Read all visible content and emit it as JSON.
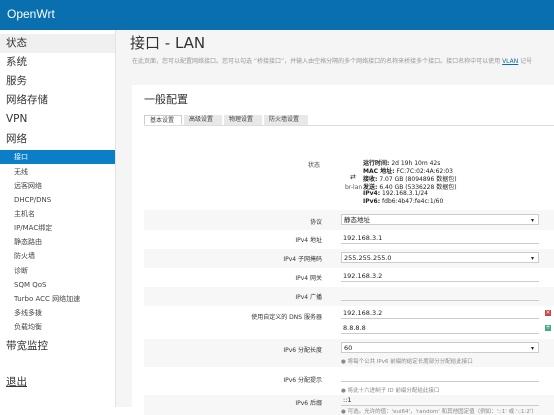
{
  "app": {
    "brand": "OpenWrt"
  },
  "sidebar": {
    "items": [
      {
        "label": "状态"
      },
      {
        "label": "系统"
      },
      {
        "label": "服务"
      },
      {
        "label": "网络存储"
      },
      {
        "label": "VPN"
      },
      {
        "label": "网络"
      }
    ],
    "network_sub": [
      {
        "label": "接口"
      },
      {
        "label": "无线"
      },
      {
        "label": "远客网络"
      },
      {
        "label": "DHCP/DNS"
      },
      {
        "label": "主机名"
      },
      {
        "label": "IP/MAC绑定"
      },
      {
        "label": "静态路由"
      },
      {
        "label": "防火墙"
      },
      {
        "label": "诊断"
      },
      {
        "label": "SQM QoS"
      },
      {
        "label": "Turbo ACC 网络加速"
      },
      {
        "label": "多线多拨"
      },
      {
        "label": "负载均衡"
      }
    ],
    "bandwidth": "带宽监控",
    "logout": "退出"
  },
  "page": {
    "title": "接口 - LAN",
    "desc": "在此页面，您可以配置网络接口。您可以勾选 “桥接接口”，并输入由空格分隔的多个网络接口的名称来桥接多个接口。接口名称中可以使用",
    "desc_link": "VLAN",
    "desc_tail": "记号"
  },
  "section": {
    "title": "一般配置"
  },
  "tabs": [
    {
      "label": "基本设置"
    },
    {
      "label": "高级设置"
    },
    {
      "label": "物理设置"
    },
    {
      "label": "防火墙设置"
    }
  ],
  "status": {
    "label": "状态",
    "iface": "br-lan",
    "lines": [
      {
        "k": "运行时间:",
        "v": " 2d 19h 10m 42s"
      },
      {
        "k": "MAC 地址:",
        "v": " FC:7C:02:4A:62:03"
      },
      {
        "k": "接收:",
        "v": " 7.07 GB (8094896 数据包)"
      },
      {
        "k": "发送:",
        "v": " 6.40 GB (5336228 数据包)"
      },
      {
        "k": "IPv4:",
        "v": " 192.168.3.1/24"
      },
      {
        "k": "IPv6:",
        "v": " fdb6:4b47:fe4c:1/60"
      }
    ]
  },
  "form": {
    "protocol": {
      "label": "协议",
      "value": "静态地址"
    },
    "ipv4_addr": {
      "label": "IPv4 地址",
      "value": "192.168.3.1"
    },
    "ipv4_mask": {
      "label": "IPv4 子网掩码",
      "value": "255.255.255.0"
    },
    "ipv4_gw": {
      "label": "IPv4 网关",
      "value": "192.168.3.2"
    },
    "ipv4_bcast": {
      "label": "IPv4 广播",
      "value": ""
    },
    "dns": {
      "label": "使用自定义的 DNS 服务器",
      "values": [
        "192.168.3.2",
        "8.8.8.8"
      ]
    },
    "ipv6_len": {
      "label": "IPv6 分配长度",
      "value": "60",
      "hint": "将每个公共 IPv6 前缀的给定长度部分分配给此接口"
    },
    "ipv6_hint": {
      "label": "IPv6 分配提示",
      "value": "",
      "hint": "将此十六进制子 ID 前缀分配给此接口"
    },
    "ipv6_suffix": {
      "label": "IPv6 后缀",
      "value": "::1",
      "hint": "可选。允许的值：'eui64'，'random' 和其他固定值（例如：'::1' 或 '::1:2'）"
    }
  }
}
